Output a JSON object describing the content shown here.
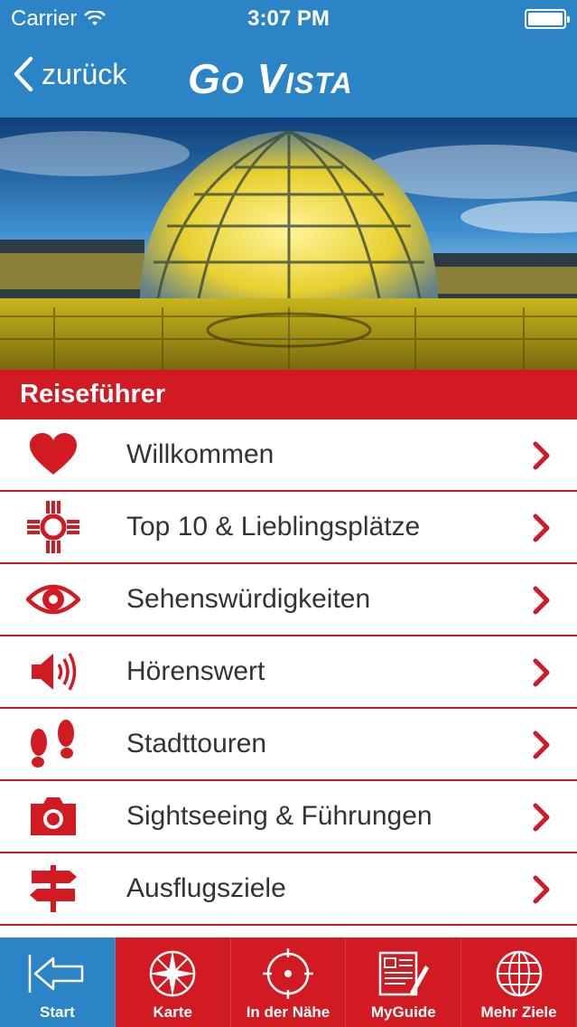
{
  "status_bar": {
    "carrier": "Carrier",
    "time": "3:07 PM"
  },
  "nav": {
    "back_label": "zurück",
    "logo_text": "Go Vista"
  },
  "section": {
    "title": "Reiseführer"
  },
  "menu": [
    {
      "label": "Willkommen",
      "icon": "heart-icon"
    },
    {
      "label": "Top 10 & Lieblingsplätze",
      "icon": "sun-symbol-icon"
    },
    {
      "label": "Sehenswürdigkeiten",
      "icon": "eye-icon"
    },
    {
      "label": "Hörenswert",
      "icon": "speaker-icon"
    },
    {
      "label": "Stadttouren",
      "icon": "footprints-icon"
    },
    {
      "label": "Sightseeing & Führungen",
      "icon": "camera-icon"
    },
    {
      "label": "Ausflugsziele",
      "icon": "signpost-icon"
    }
  ],
  "tabs": [
    {
      "label": "Start",
      "icon": "back-arrow-icon",
      "active": true
    },
    {
      "label": "Karte",
      "icon": "compass-icon",
      "active": false
    },
    {
      "label": "In der Nähe",
      "icon": "target-icon",
      "active": false
    },
    {
      "label": "MyGuide",
      "icon": "notes-icon",
      "active": false
    },
    {
      "label": "Mehr Ziele",
      "icon": "globe-icon",
      "active": false
    }
  ],
  "colors": {
    "brand_blue": "#2a84c6",
    "brand_red": "#d21a22"
  }
}
